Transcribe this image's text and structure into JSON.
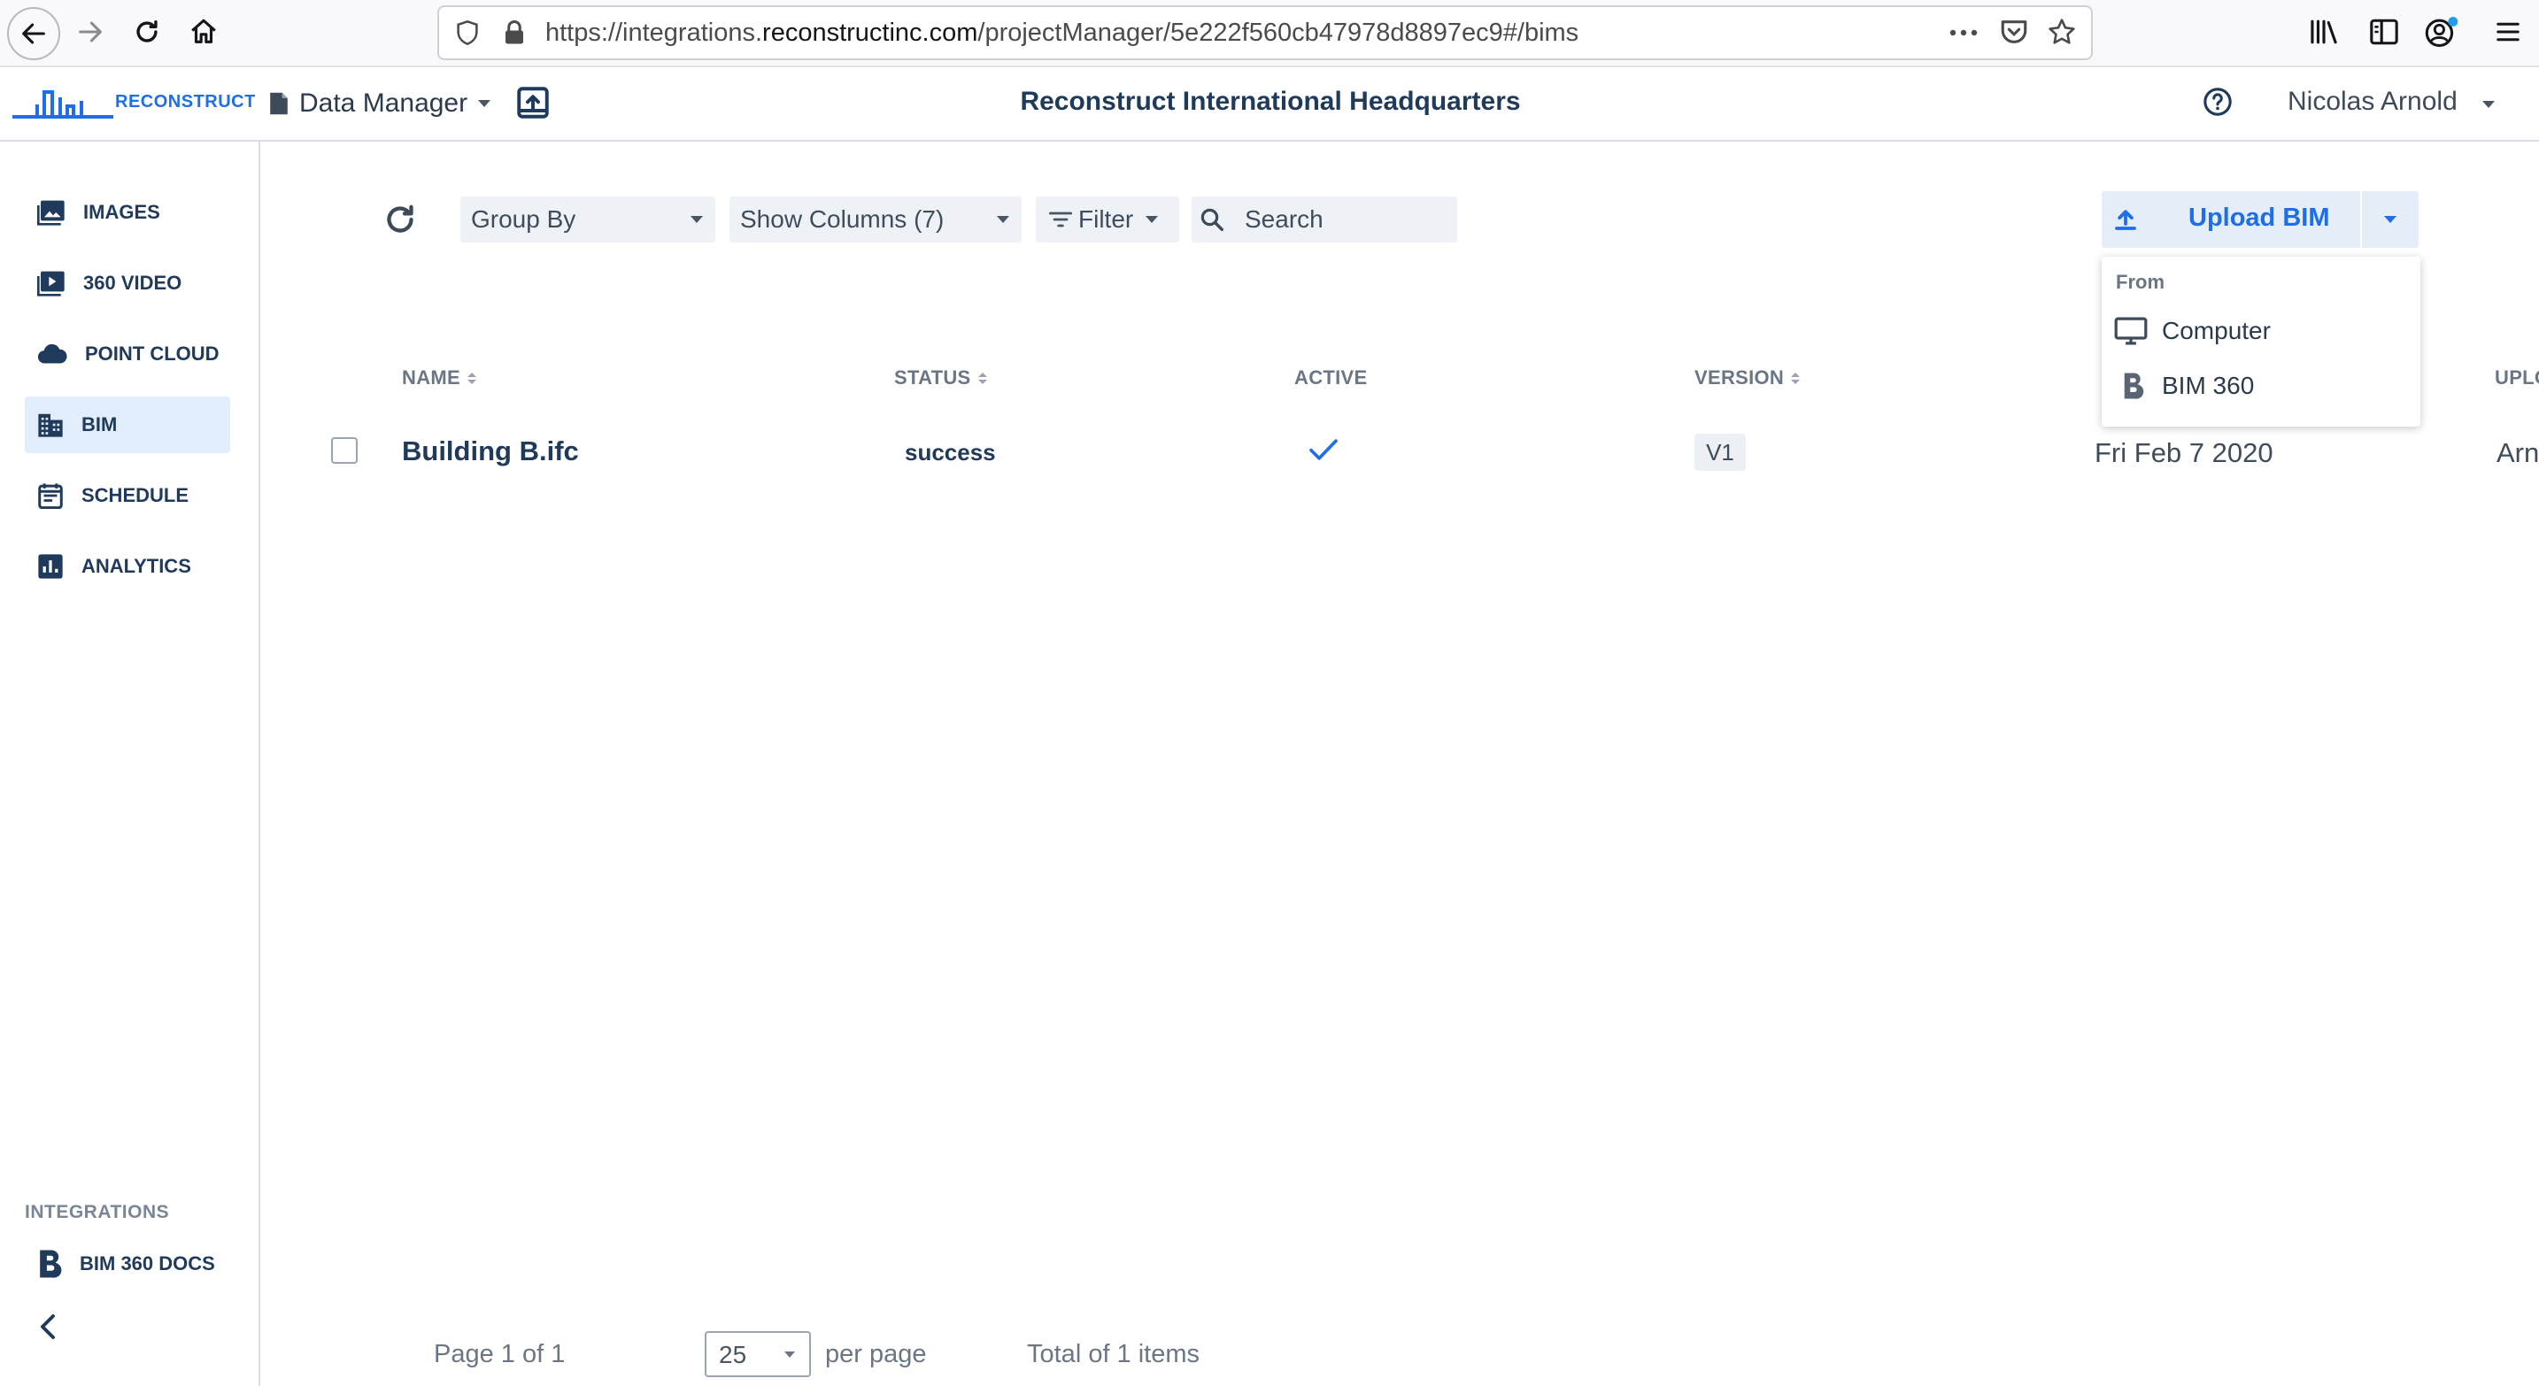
{
  "browser": {
    "url_prefix": "https://integrations.",
    "url_domain": "reconstructinc.com",
    "url_path": "/projectManager/5e222f560cb47978d8897ec9#/bims"
  },
  "header": {
    "logo_text": "RECONSTRUCT",
    "data_manager_label": "Data Manager",
    "project_title": "Reconstruct International Headquarters",
    "user_name": "Nicolas Arnold"
  },
  "sidebar": {
    "items": [
      {
        "label": "IMAGES",
        "icon": "image-icon"
      },
      {
        "label": "360 VIDEO",
        "icon": "video-icon"
      },
      {
        "label": "POINT CLOUD",
        "icon": "cloud-icon"
      },
      {
        "label": "BIM",
        "icon": "building-icon",
        "active": true
      },
      {
        "label": "SCHEDULE",
        "icon": "calendar-icon"
      },
      {
        "label": "ANALYTICS",
        "icon": "bar-chart-icon"
      }
    ],
    "integrations_label": "INTEGRATIONS",
    "integration_items": [
      {
        "label": "BIM 360 DOCS",
        "icon": "bim360-icon"
      }
    ]
  },
  "toolbar": {
    "group_by_label": "Group By",
    "show_columns_label": "Show Columns (7)",
    "filter_label": "Filter",
    "search_placeholder": "Search",
    "upload_label": "Upload BIM"
  },
  "upload_menu": {
    "from_label": "From",
    "items": [
      {
        "label": "Computer",
        "icon": "monitor-icon"
      },
      {
        "label": "BIM 360",
        "icon": "bim360-icon"
      }
    ]
  },
  "table": {
    "columns": {
      "name": "NAME",
      "status": "STATUS",
      "active": "ACTIVE",
      "version": "VERSION",
      "uploaded": "UPLO"
    },
    "rows": [
      {
        "name": "Building B.ifc",
        "status": "success",
        "active": true,
        "version": "V1",
        "date": "Fri Feb 7 2020",
        "uploader": "Arn"
      }
    ]
  },
  "pagination": {
    "page_text": "Page 1 of 1",
    "per_page_value": "25",
    "per_page_label": "per page",
    "total_text": "Total of 1 items"
  },
  "colors": {
    "accent": "#1d6ee8",
    "text_primary": "#1f3a5a",
    "active_bg": "#e1edfb"
  }
}
